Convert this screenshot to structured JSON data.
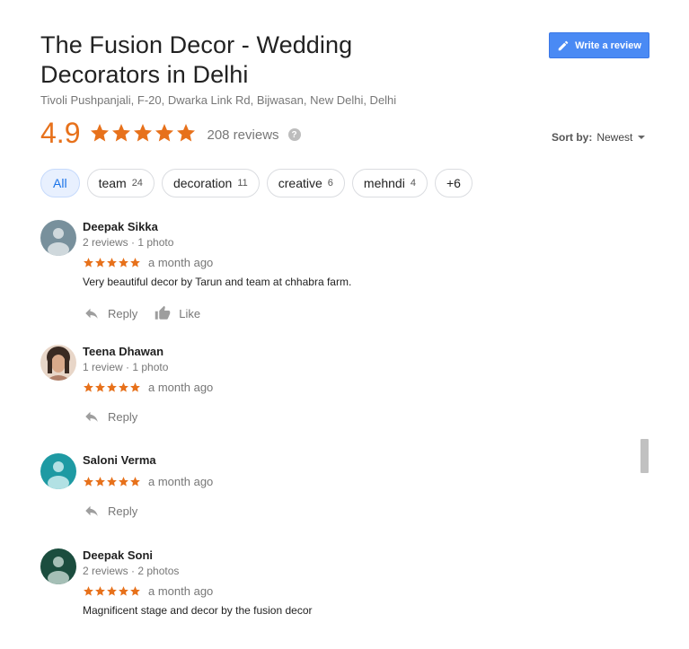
{
  "business": {
    "title_line1": "The Fusion Decor - Wedding",
    "title_line2": "Decorators in Delhi",
    "address": "Tivoli Pushpanjali, F-20, Dwarka Link Rd, Bijwasan, New Delhi, Delhi"
  },
  "write_review_label": "Write a review",
  "rating": {
    "value": "4.9",
    "stars": 5,
    "reviews_label": "208 reviews",
    "help": "?"
  },
  "sort": {
    "label": "Sort by:",
    "value": "Newest"
  },
  "chips": [
    {
      "label": "All",
      "count": ""
    },
    {
      "label": "team",
      "count": "24"
    },
    {
      "label": "decoration",
      "count": "11"
    },
    {
      "label": "creative",
      "count": "6"
    },
    {
      "label": "mehndi",
      "count": "4"
    },
    {
      "label": "+6",
      "count": ""
    }
  ],
  "actions": {
    "reply": "Reply",
    "like": "Like"
  },
  "reviews": [
    {
      "name": "Deepak Sikka",
      "meta": "2 reviews · 1 photo",
      "stars": 5,
      "time": "a month ago",
      "text": "Very beautiful decor by Tarun and team at chhabra farm."
    },
    {
      "name": "Teena Dhawan",
      "meta": "1 review · 1 photo",
      "stars": 5,
      "time": "a month ago",
      "text": ""
    },
    {
      "name": "Saloni Verma",
      "meta": "",
      "stars": 5,
      "time": "a month ago",
      "text": ""
    },
    {
      "name": "Deepak Soni",
      "meta": "2 reviews · 2 photos",
      "stars": 5,
      "time": "a month ago",
      "text": "Magnificent stage and decor by the fusion decor"
    }
  ],
  "colors": {
    "star": "#e7711b",
    "accent": "#4a8af4",
    "avatar1": "#78909c",
    "avatar3": "#1e9aa3",
    "avatar4": "#1b4d3e"
  }
}
